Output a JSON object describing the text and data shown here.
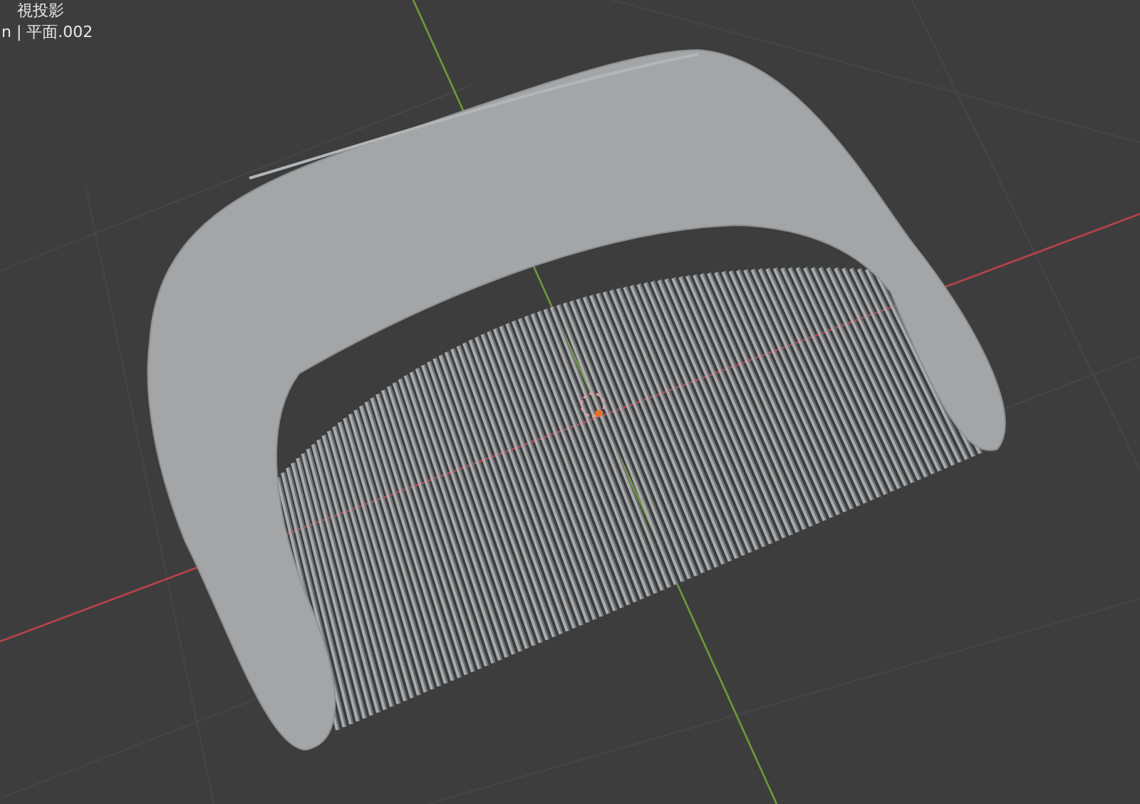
{
  "viewport": {
    "view_label": "視投影",
    "object_label": "n | 平面.002"
  }
}
